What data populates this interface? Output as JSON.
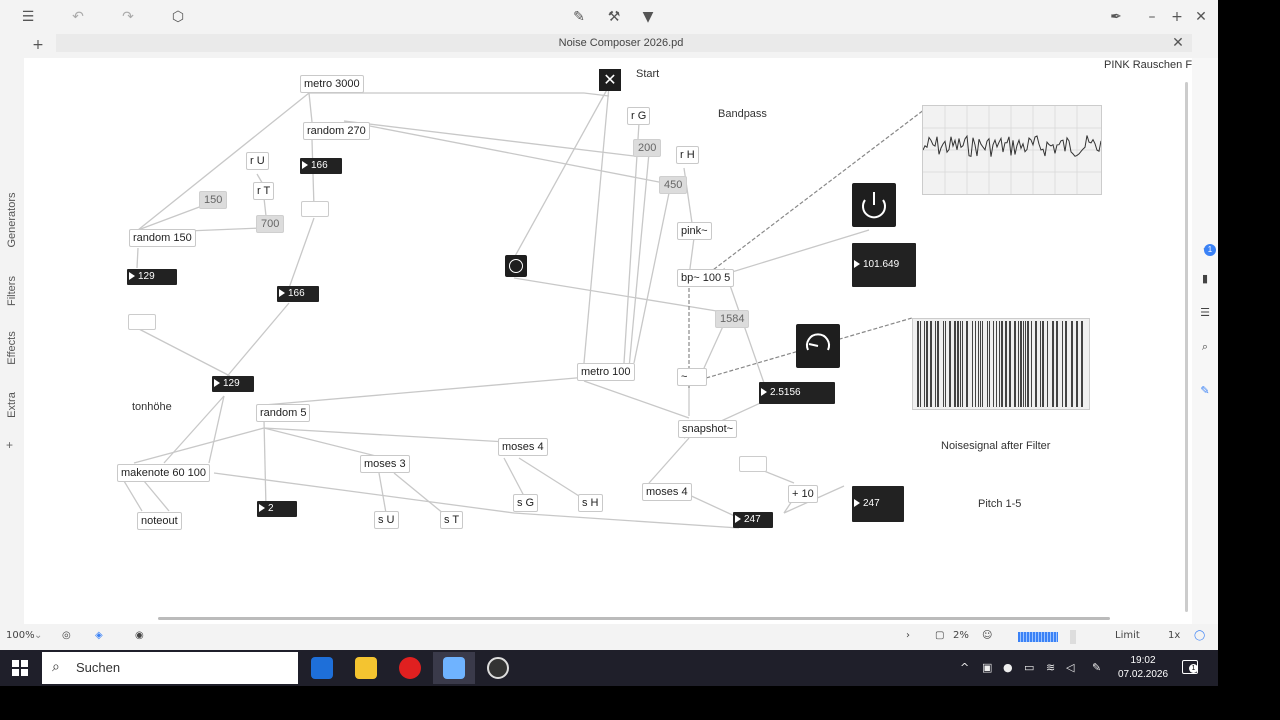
{
  "window": {
    "title": "Noise Composer 2026.pd"
  },
  "sidebar": {
    "tabs": [
      "Generators",
      "Filters",
      "Effects",
      "Extra"
    ],
    "add": "+"
  },
  "patch": {
    "objects": {
      "metro3000": "metro 3000",
      "random270": "random 270",
      "rU": "r U",
      "rT": "r T",
      "random150": "random 150",
      "random5": "random 5",
      "makenote": "makenote 60 100",
      "noteout": "noteout",
      "moses3": "moses 3",
      "moses4a": "moses 4",
      "moses4b": "moses 4",
      "sU": "s U",
      "sT": "s T",
      "sG": "s G",
      "sH": "s H",
      "rG": "r G",
      "rH": "r H",
      "pink": "pink~",
      "bp": "bp~ 100 5",
      "metro100": "metro 100",
      "snapshot": "snapshot~",
      "plus10": "+ 10",
      "tilde": "~"
    },
    "messages": {
      "m150": "150",
      "m700": "700",
      "m200": "200",
      "m450": "450",
      "m1584": "1584"
    },
    "numbers": {
      "n166a": "166",
      "n129a": "129",
      "n166b": "166",
      "n129b": "129",
      "n2": "2",
      "n101": "101.649",
      "n2_5156": "2.5156",
      "n247a": "247",
      "n247b": "247"
    },
    "comments": {
      "start": "Start",
      "bandpass": "Bandpass",
      "pink_rauschen": "PINK Rauschen F",
      "tonhoehe": "tonhöhe",
      "noisesignal": "Noisesignal after Filter",
      "pitch": "Pitch 1-5"
    }
  },
  "statusbar": {
    "zoom": "100%",
    "cpu": "2%",
    "limit": "Limit",
    "speed": "1x"
  },
  "taskbar": {
    "search_placeholder": "Suchen",
    "time": "19:02",
    "date": "07.02.2026",
    "notifications": "1"
  },
  "colors": {
    "number_box": "#222222",
    "canvas": "#ffffff",
    "taskbar": "#1f1f2a"
  }
}
